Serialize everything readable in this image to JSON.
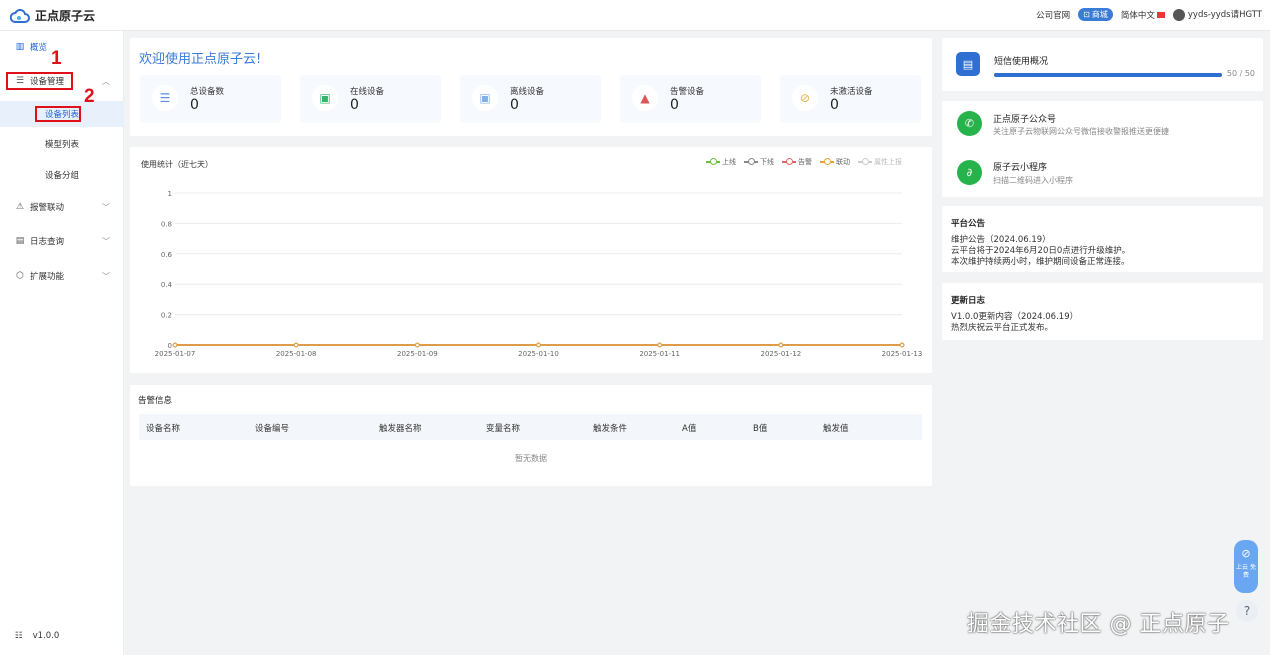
{
  "app": {
    "title": "正点原子云"
  },
  "topbar": {
    "official_site": "公司官网",
    "shop": "商城",
    "language": "简体中文",
    "user": "yyds-yyds请HGTT"
  },
  "sidebar": {
    "overview": "概览",
    "device_mgmt": "设备管理",
    "device_list": "设备列表",
    "model_list": "模型列表",
    "device_group": "设备分组",
    "alarm_link": "报警联动",
    "log_query": "日志查询",
    "ext_func": "扩展功能",
    "version": "v1.0.0"
  },
  "annotations": {
    "n1": "1",
    "n2": "2"
  },
  "welcome": {
    "title": "欢迎使用正点原子云!",
    "stats": [
      {
        "label": "总设备数",
        "value": "0",
        "icon": "database-icon"
      },
      {
        "label": "在线设备",
        "value": "0",
        "icon": "online-device-icon"
      },
      {
        "label": "离线设备",
        "value": "0",
        "icon": "offline-device-icon"
      },
      {
        "label": "告警设备",
        "value": "0",
        "icon": "alarm-light-icon"
      },
      {
        "label": "未激活设备",
        "value": "0",
        "icon": "inactive-device-icon"
      }
    ]
  },
  "usage_chart": {
    "title": "使用统计（近七天）",
    "legend": [
      {
        "name": "上线",
        "color": "#67c23a"
      },
      {
        "name": "下线",
        "color": "#888888"
      },
      {
        "name": "告警",
        "color": "#e06666"
      },
      {
        "name": "联动",
        "color": "#e6a23c"
      },
      {
        "name": "属性上报",
        "color": "#cccccc"
      }
    ]
  },
  "chart_data": {
    "type": "line",
    "title": "使用统计（近七天）",
    "x": [
      "2025-01-07",
      "2025-01-08",
      "2025-01-09",
      "2025-01-10",
      "2025-01-11",
      "2025-01-12",
      "2025-01-13"
    ],
    "yticks": [
      "0",
      "0.2",
      "0.4",
      "0.6",
      "0.8",
      "1"
    ],
    "ylim": [
      0,
      1
    ],
    "grid": true,
    "legend_position": "top-right",
    "series": [
      {
        "name": "上线",
        "values": [
          0,
          0,
          0,
          0,
          0,
          0,
          0
        ],
        "color": "#67c23a"
      },
      {
        "name": "下线",
        "values": [
          0,
          0,
          0,
          0,
          0,
          0,
          0
        ],
        "color": "#888888"
      },
      {
        "name": "告警",
        "values": [
          0,
          0,
          0,
          0,
          0,
          0,
          0
        ],
        "color": "#e06666"
      },
      {
        "name": "联动",
        "values": [
          0,
          0,
          0,
          0,
          0,
          0,
          0
        ],
        "color": "#e6a23c"
      }
    ]
  },
  "alarm_info": {
    "title": "告警信息",
    "columns": [
      "设备名称",
      "设备编号",
      "触发器名称",
      "变量名称",
      "触发条件",
      "A值",
      "B值",
      "触发值"
    ],
    "empty": "暂无数据"
  },
  "sms": {
    "title": "短信使用概况",
    "used": 50,
    "total": 50,
    "text": "50 / 50"
  },
  "wechat": {
    "title": "正点原子公众号",
    "desc": "关注原子云物联网公众号微信接收警报推送更便捷"
  },
  "miniapp": {
    "title": "原子云小程序",
    "desc": "扫描二维码进入小程序"
  },
  "announcement": {
    "title": "平台公告",
    "lines": [
      "维护公告（2024.06.19）",
      "云平台将于2024年6月20日0点进行升级维护。",
      "本次维护持续两小时，维护期间设备正常连接。"
    ]
  },
  "changelog": {
    "title": "更新日志",
    "lines": [
      "V1.0.0更新内容（2024.06.19）",
      "热烈庆祝云平台正式发布。"
    ]
  },
  "float": {
    "label": "上云 免费"
  },
  "help": {
    "label": "?"
  },
  "watermark": "掘金技术社区 @ 正点原子"
}
